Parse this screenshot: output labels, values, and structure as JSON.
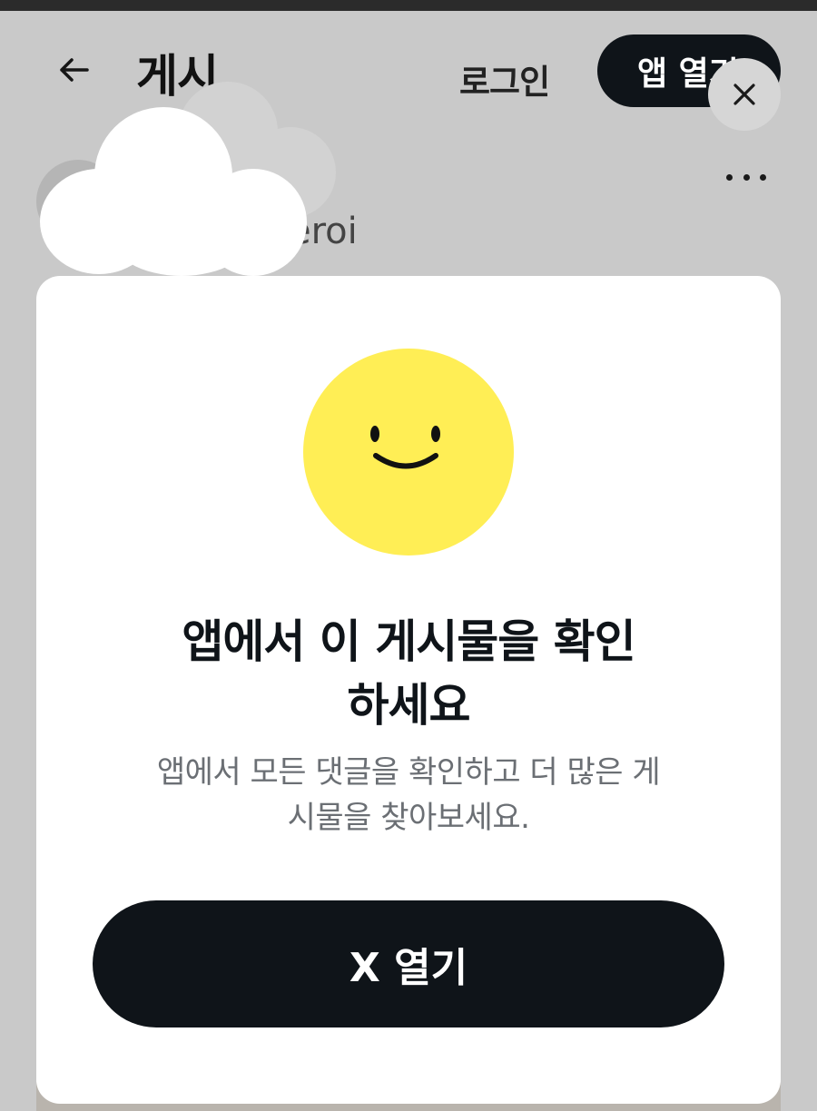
{
  "header": {
    "back_icon_name": "back-arrow-icon",
    "title": "게시",
    "login_label": "로그인",
    "open_app_label": "앱 열기",
    "close_icon_name": "close-icon"
  },
  "post": {
    "handle_partial": "eroi",
    "more_icon_name": "more-dots-icon"
  },
  "dialog": {
    "icon_name": "smiley-face-icon",
    "icon_color": "#FFEE55",
    "headline_line1": "앱에서 이 게시물을 확인",
    "headline_line2": "하세요",
    "subtext_line1": "앱에서 모든 댓글을 확인하고 더 많은 게",
    "subtext_line2": "시물을 찾아보세요.",
    "button_label": "X 열기"
  },
  "colors": {
    "dim_background": "#c9c9c9",
    "button_background": "#0f1419",
    "button_text": "#ffffff",
    "subtext": "#6b6f74"
  }
}
